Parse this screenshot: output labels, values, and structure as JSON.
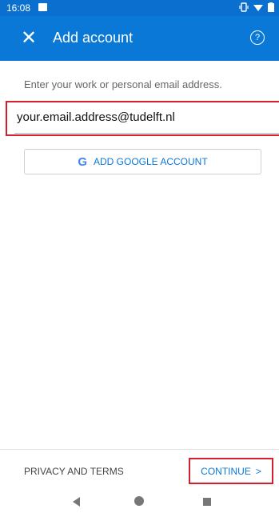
{
  "status_bar": {
    "time": "16:08"
  },
  "app_bar": {
    "close_label": "✕",
    "title": "Add account",
    "help_label": "?"
  },
  "form": {
    "prompt": "Enter your work or personal email address.",
    "email_value": "your.email.address@tudelft.nl",
    "google_button": "ADD GOOGLE ACCOUNT",
    "google_icon": "G"
  },
  "footer": {
    "privacy": "PRIVACY AND TERMS",
    "continue": "CONTINUE",
    "continue_chevron": ">"
  },
  "colors": {
    "primary": "#0a78d6",
    "highlight": "#d41f2c"
  }
}
